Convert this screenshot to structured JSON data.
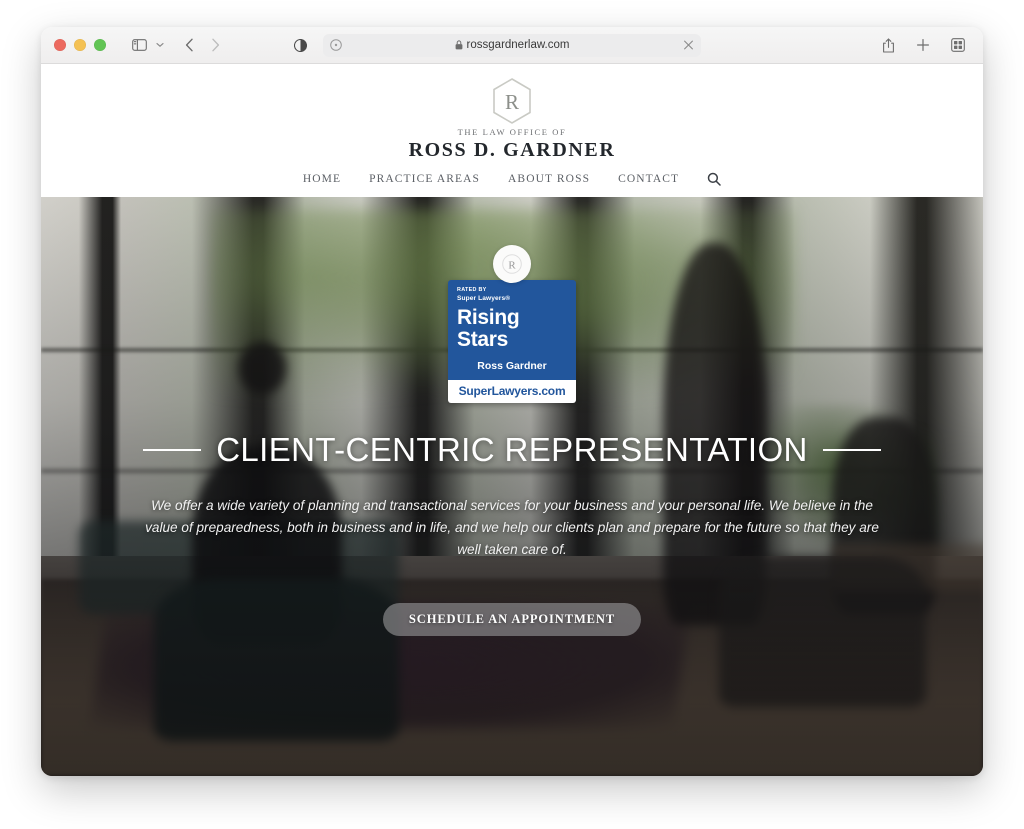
{
  "browser": {
    "traffic_lights": [
      "close",
      "minimize",
      "maximize"
    ],
    "sidebar_icon": "sidebar-icon",
    "sidebar_chevron_icon": "chevron-down-icon",
    "back_icon": "chevron-left-icon",
    "forward_icon": "chevron-right-icon",
    "reader_icon": "reader-contrast-icon",
    "extensions_icon": "puzzle-circle-icon",
    "lock_icon": "lock-icon",
    "url": "rossgardnerlaw.com",
    "stop_icon": "close-icon",
    "share_icon": "share-icon",
    "new_tab_icon": "plus-icon",
    "tab_overview_icon": "tab-grid-icon"
  },
  "site": {
    "logo_letter": "R",
    "kicker": "THE LAW OFFICE OF",
    "name": "ROSS D. GARDNER",
    "nav": [
      {
        "label": "HOME"
      },
      {
        "label": "PRACTICE AREAS"
      },
      {
        "label": "ABOUT ROSS"
      },
      {
        "label": "CONTACT"
      }
    ],
    "search_icon": "search-icon",
    "scroll_badge_letter": "R"
  },
  "badge": {
    "rated_by": "RATED BY",
    "org": "Super Lawyers®",
    "award": "Rising Stars",
    "attorney": "Ross Gardner",
    "site": "SuperLawyers.com",
    "brand_color": "#22569c"
  },
  "hero": {
    "headline": "CLIENT-CENTRIC REPRESENTATION",
    "paragraph": "We offer a wide variety of planning and transactional services for your business and your personal life. We believe in the value of preparedness, both in business and in life, and we help our clients plan and prepare for the future so that they are well taken care of.",
    "cta_label": "SCHEDULE AN APPOINTMENT"
  }
}
